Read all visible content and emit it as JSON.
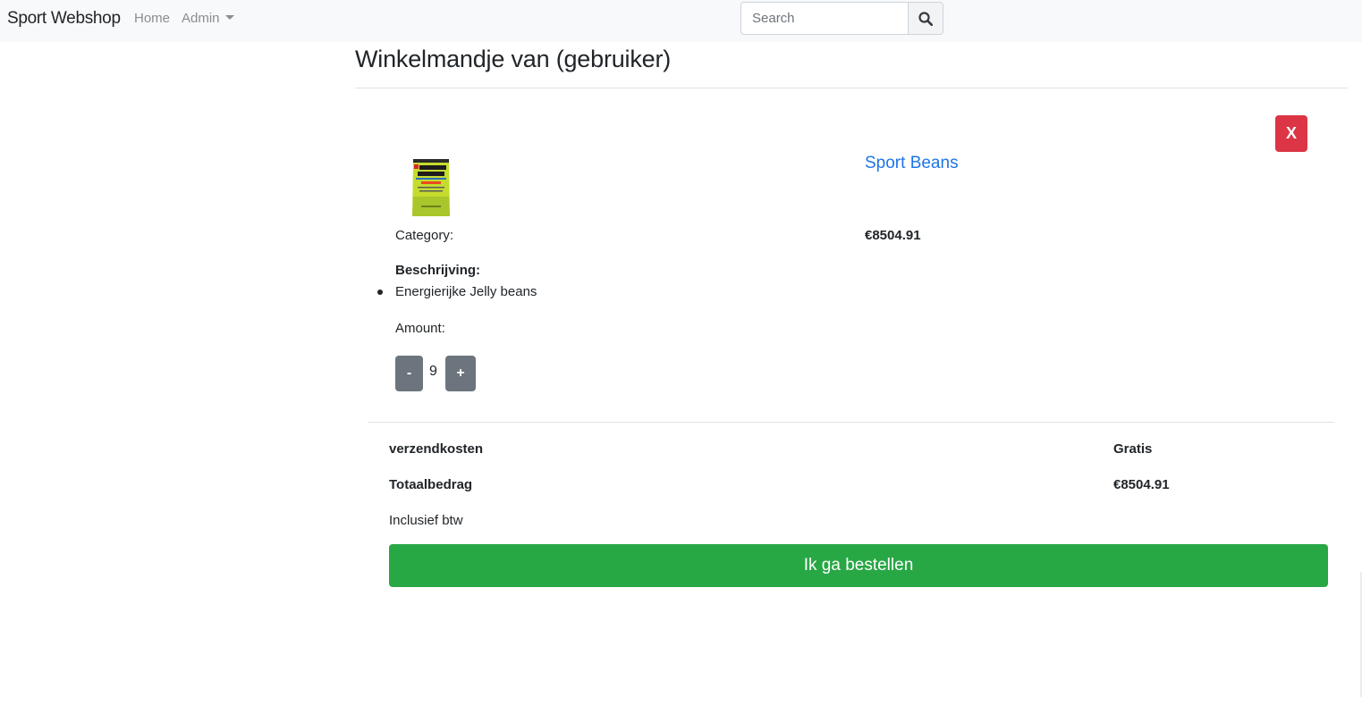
{
  "navbar": {
    "brand": "Sport Webshop",
    "home": "Home",
    "admin": "Admin",
    "search_placeholder": "Search",
    "search_icon": "search-icon"
  },
  "page": {
    "title": "Winkelmandje van (gebruiker)"
  },
  "cart_item": {
    "remove_label": "X",
    "image_icon": "product-image-sport-beans",
    "name": "Sport Beans",
    "category_label": "Category:",
    "price": "€8504.91",
    "description_heading": "Beschrijving:",
    "description_items": [
      "Energierijke Jelly beans"
    ],
    "amount_label": "Amount:",
    "decrement_label": "-",
    "quantity": "9",
    "increment_label": "+"
  },
  "summary": {
    "shipping_label": "verzendkosten",
    "shipping_value": "Gratis",
    "total_label": "Totaalbedrag",
    "total_value": "€8504.91",
    "vat_note": "Inclusief btw",
    "order_button": "Ik ga bestellen"
  },
  "colors": {
    "navbar_bg": "#f8f9fa",
    "link": "#1f75e6",
    "danger": "#dc3545",
    "secondary": "#6c757d",
    "success": "#28a745"
  }
}
